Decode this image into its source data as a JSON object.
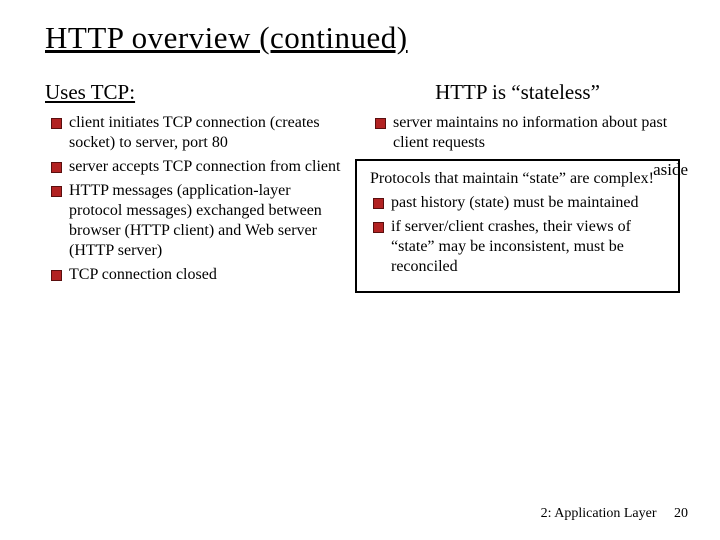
{
  "title": "HTTP overview (continued)",
  "left": {
    "heading": "Uses TCP:",
    "items": [
      "client initiates TCP connection (creates socket) to server, port 80",
      "server accepts TCP connection from client",
      "HTTP messages (application-layer protocol messages) exchanged between browser (HTTP client) and Web server (HTTP server)",
      "TCP connection closed"
    ]
  },
  "right": {
    "heading": "HTTP is “stateless”",
    "items": [
      "server maintains no information about past client requests"
    ]
  },
  "aside": {
    "label": "aside",
    "intro": "Protocols that maintain “state” are complex!",
    "items": [
      "past history (state) must be maintained",
      "if server/client crashes, their views of “state” may be inconsistent, must be reconciled"
    ]
  },
  "footer": {
    "chapter": "2: Application Layer",
    "page": "20"
  }
}
